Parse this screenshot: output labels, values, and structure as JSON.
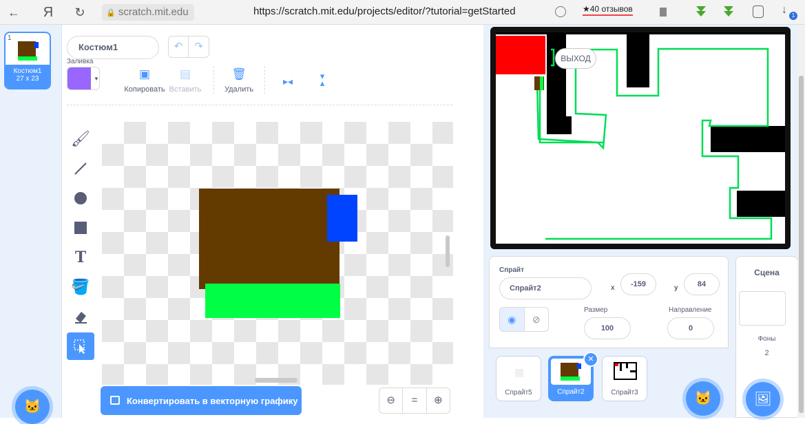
{
  "browser": {
    "domain": "scratch.mit.edu",
    "url": "https://scratch.mit.edu/projects/editor/?tutorial=getStarted",
    "reviews": "★40 отзывов",
    "back": "←",
    "yandex": "Я",
    "reload": "↻",
    "lock": "🔒",
    "badge_count": "1"
  },
  "costumes": {
    "items": [
      {
        "number": "1",
        "name": "Костюм1",
        "size": "27 x 23"
      }
    ]
  },
  "paint": {
    "costume_name": "Костюм1",
    "fill_label": "Заливка",
    "fill_color": "#9966ff",
    "copy_label": "Копировать",
    "paste_label": "Вставить",
    "delete_label": "Удалить",
    "convert_label": "Конвертировать в векторную графику",
    "zoom_out": "⊖",
    "zoom_reset": "=",
    "zoom_in": "⊕",
    "tool_text": "T"
  },
  "stage": {
    "say_text": "ВЫХОД"
  },
  "sprite_info": {
    "sprite_label": "Спрайт",
    "sprite_name": "Спрайт2",
    "x_label": "x",
    "x_value": "-159",
    "y_label": "y",
    "y_value": "84",
    "size_label": "Размер",
    "size_value": "100",
    "direction_label": "Направление",
    "direction_value": "0"
  },
  "sprites": [
    {
      "name": "Спрайт5",
      "selected": false
    },
    {
      "name": "Спрайт2",
      "selected": true
    },
    {
      "name": "Спрайт3",
      "selected": false
    }
  ],
  "stage_panel": {
    "title": "Сцена",
    "backdrops_label": "Фоны",
    "backdrops_count": "2"
  },
  "colors": {
    "accent": "#4c97ff",
    "brown": "#633a00",
    "green": "#00ff44",
    "blue": "#0044ff",
    "red": "#ff0000"
  }
}
